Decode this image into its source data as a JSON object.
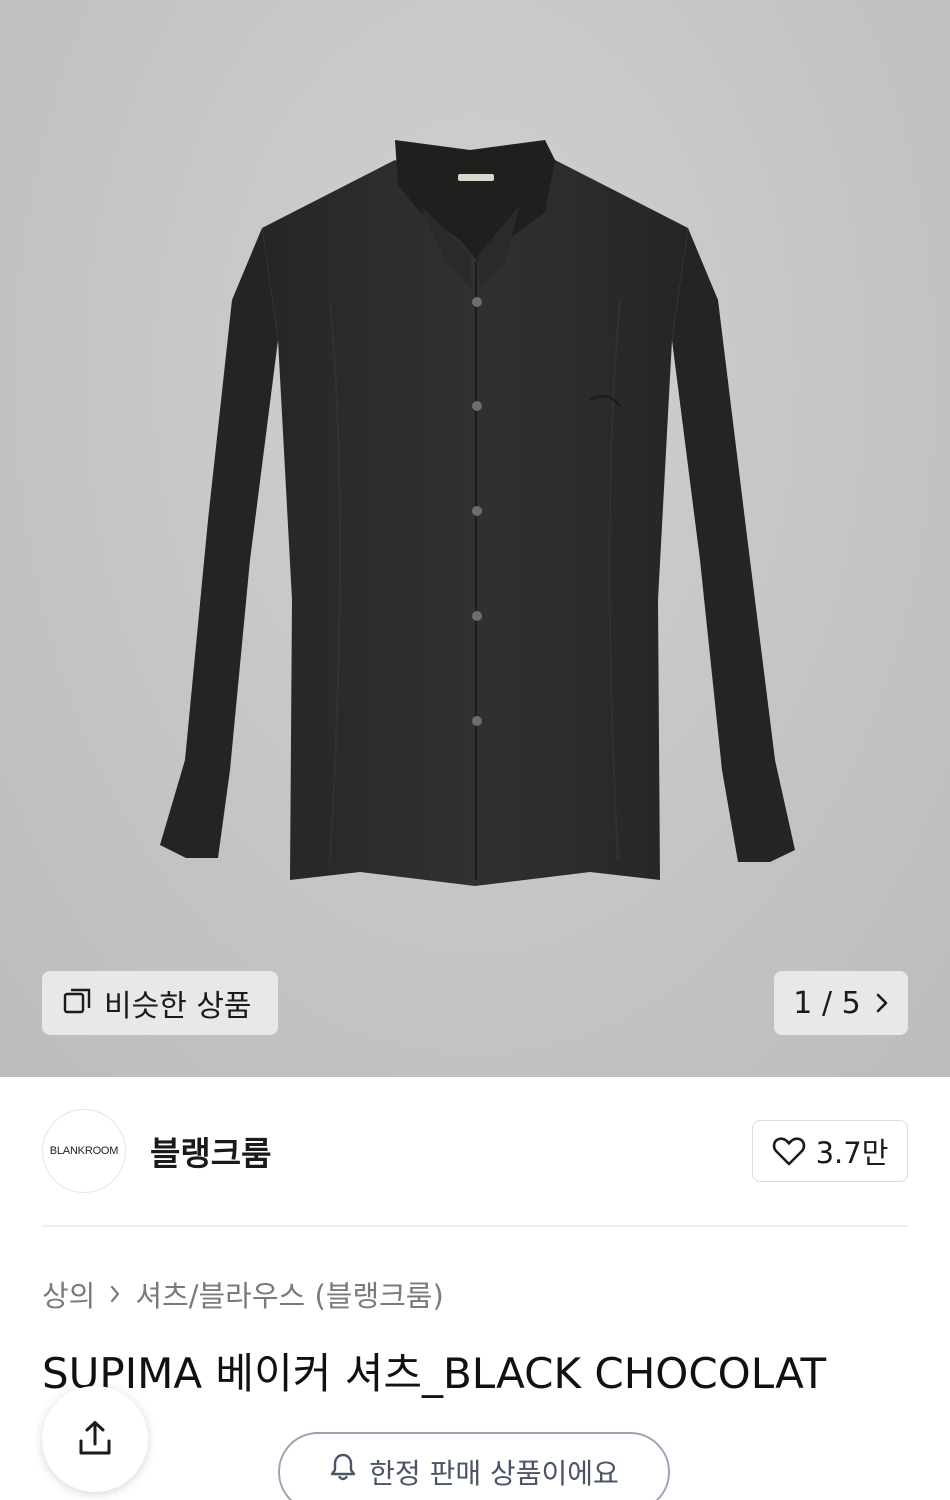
{
  "gallery": {
    "similar_label": "비슷한 상품",
    "counter_current": "1",
    "counter_separator": "/",
    "counter_total": "5"
  },
  "seller": {
    "logo_text": "BLANKROOM",
    "name": "블랭크룸",
    "like_count": "3.7만"
  },
  "breadcrumb": {
    "level1": "상의",
    "level2": "셔츠/블라우스 (블랭크룸)"
  },
  "product": {
    "title": "SUPIMA 베이커 셔츠_BLACK CHOCOLAT"
  },
  "bottom": {
    "limited_label": "한정 판매 상품이에요"
  },
  "colors": {
    "background": "#c8c6c7",
    "shirt": "#2b2b2a",
    "pill_border": "#9aa3b4"
  }
}
